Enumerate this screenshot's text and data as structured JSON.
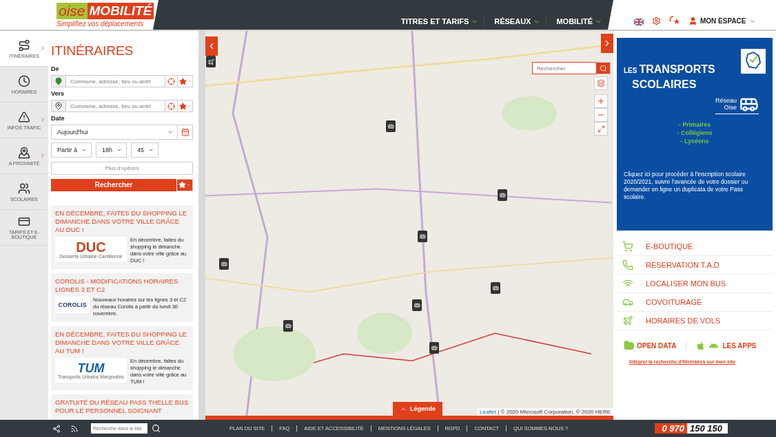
{
  "header": {
    "logo": {
      "word_1": "oise",
      "word_2": "MOBILITÉ",
      "tagline": "Simplifiez vos déplacements"
    },
    "nav": [
      {
        "label": "TITRES ET TARIFS"
      },
      {
        "label": "RÉSEAUX"
      },
      {
        "label": "MOBILITÉ"
      }
    ],
    "account": {
      "label": "MON ESPACE"
    }
  },
  "sidebar": {
    "items": [
      {
        "label": "ITINÉRAIRES",
        "selected": true,
        "arrow": true
      },
      {
        "label": "HORAIRES",
        "selected": false,
        "arrow": false
      },
      {
        "label": "INFOS TRAFIC",
        "selected": false,
        "arrow": true
      },
      {
        "label": "A PROXIMITÉ",
        "selected": false,
        "arrow": true
      },
      {
        "label": "SCOLAIRES",
        "selected": false,
        "arrow": false
      },
      {
        "label": "TARIFS ET E-BOUTIQUE",
        "selected": false,
        "arrow": false
      }
    ]
  },
  "planner": {
    "title": "ITINÉRAIRES",
    "from": {
      "label": "De",
      "placeholder": "Commune, adresse, lieu ou arrêt"
    },
    "to": {
      "label": "Vers",
      "placeholder": "Commune, adresse, lieu ou arrêt"
    },
    "date": {
      "label": "Date",
      "value": "Aujourd'hui"
    },
    "time": {
      "mode": "Partir à",
      "hour": "18h",
      "minute": "45"
    },
    "more_options": "Plus d'options",
    "search_button": "Rechercher"
  },
  "news": [
    {
      "title": "EN DÉCEMBRE, FAITES DU SHOPPING LE DIMANCHE DANS VOTRE VILLE GRÂCE AU DUC !",
      "logo_text": "DUC",
      "logo_caption": "Desserte Urbaine Cantilienne",
      "text": "En décembre, faites du shopping le dimanche dans votre ville grâce au DUC !"
    },
    {
      "title": "COROLIS - MODIFICATIONS HORAIRES LIGNES 3 ET C2",
      "logo_text": "COROLIS",
      "text": "Nouveaux horaires sur les lignes 3  et C2 du réseau Corolis à partir du lundi 30 novembre."
    },
    {
      "title": "EN DÉCEMBRE, FAITES DU SHOPPING LE DIMANCHE DANS VOTRE VILLE GRÂCE AU TUM !",
      "logo_text": "TUM",
      "logo_caption": "Transports Urbains Margnotins",
      "text": "En décembre, faites du shopping le dimanche dans votre ville grâce au TUM !"
    },
    {
      "title": "GRATUITÉ DU RÉSEAU PASS THELLE BUS POUR LE PERSONNEL SOIGNANT"
    }
  ],
  "map": {
    "search_placeholder": "Rechercher",
    "legend_button": "Légende",
    "attribution_link": "Leaflet",
    "attribution": "| © 2020 Microsoft Corporation, © 2020 HERE"
  },
  "banner": {
    "small": "LES",
    "title_1": "TRANSPORTS",
    "title_2": "SCOLAIRES",
    "network_1": "Réseau",
    "network_2": "Oise",
    "levels": [
      "- Primaires",
      "- Collégiens",
      "- Lycéens"
    ],
    "text": "Cliquez ici pour procéder à l'inscription scolaire 2020/2021, suivre l'avancée de votre dossier ou demander en ligne un duplicata de votre Pass scolaire."
  },
  "links": [
    {
      "label": "E-BOUTIQUE"
    },
    {
      "label": "RÉSERVATION T.A.D"
    },
    {
      "label": "LOCALISER MON BUS"
    },
    {
      "label": "COVOITURAGE"
    },
    {
      "label": "HORAIRES DE VOLS"
    }
  ],
  "open_data": "OPEN DATA",
  "apps": "LES APPS",
  "embed_link": "Intégrer la recherche d'itinéraires sur mon site",
  "footer": {
    "search_placeholder": "Recherche dans le site",
    "links": [
      "PLAN DU SITE",
      "FAQ",
      "AIDE ET ACCESSIBILITÉ",
      "MENTIONS LÉGALES",
      "RGPD",
      "CONTACT",
      "QUI SOMMES-NOUS ?"
    ],
    "phone_1": "0 970",
    "phone_2": "150 150"
  }
}
